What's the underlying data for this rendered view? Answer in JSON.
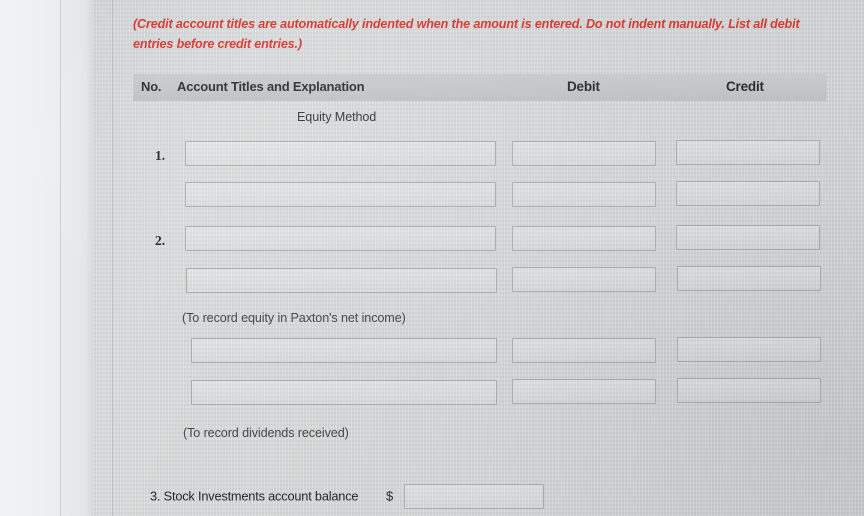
{
  "note": "(Credit account titles are automatically indented when the amount is entered. Do not indent manually. List all debit entries before credit entries.)",
  "table": {
    "headers": {
      "no": "No.",
      "account": "Account Titles and Explanation",
      "debit": "Debit",
      "credit": "Credit"
    },
    "subcaption": "Equity Method",
    "rows": [
      {
        "no": "1.",
        "account_value": "",
        "debit_value": "",
        "credit_value": ""
      },
      {
        "no": "",
        "account_value": "",
        "debit_value": "",
        "credit_value": ""
      },
      {
        "no": "2.",
        "account_value": "",
        "debit_value": "",
        "credit_value": ""
      },
      {
        "no": "",
        "account_value": "",
        "debit_value": "",
        "credit_value": ""
      },
      {
        "no": "",
        "account_value": "",
        "debit_value": "",
        "credit_value": ""
      },
      {
        "no": "",
        "account_value": "",
        "debit_value": "",
        "credit_value": ""
      }
    ],
    "memos": [
      "(To record equity in Paxton's net income)",
      "(To record dividends received)"
    ]
  },
  "balance": {
    "label": "3. Stock Investments account balance",
    "currency_symbol": "$",
    "value": ""
  },
  "colors": {
    "note_red": "#d63a31",
    "header_band": "#c3c6c7",
    "page_background": "#d4d6d7",
    "field_border": "#a9adb0",
    "text": "#2b2e30"
  }
}
